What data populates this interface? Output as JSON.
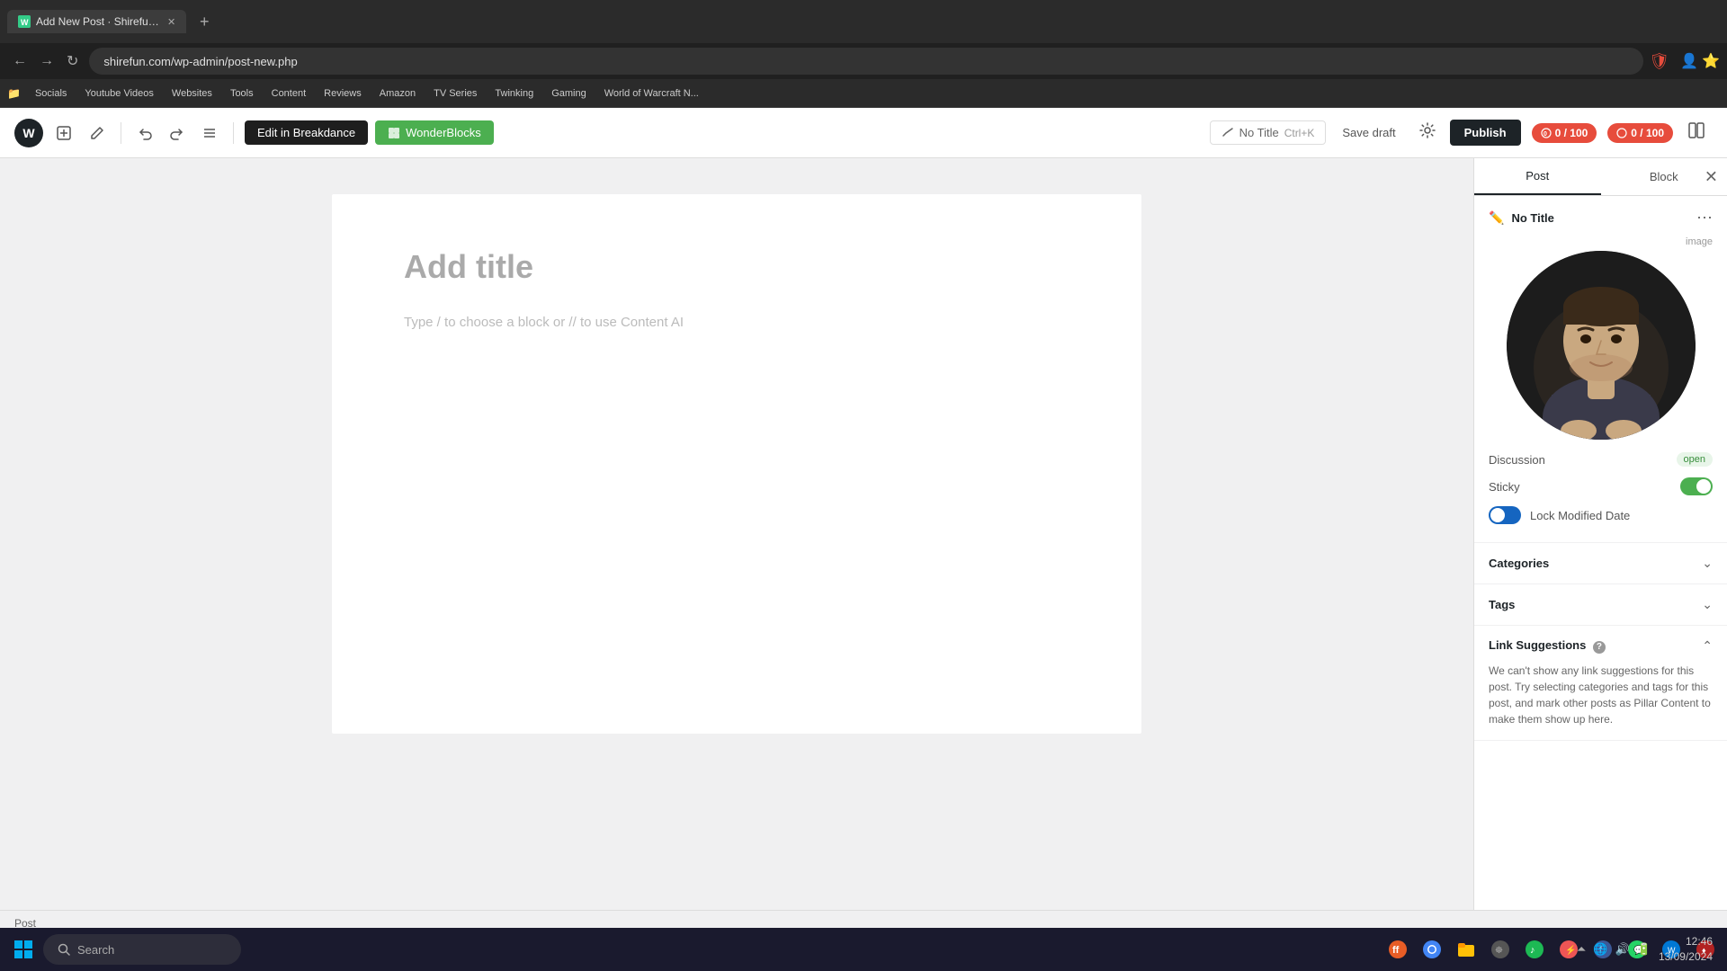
{
  "browser": {
    "tab": {
      "title": "Add New Post · Shirefun — Wo...",
      "favicon": "W"
    },
    "address": "shirefun.com/wp-admin/post-new.php",
    "bookmarks": [
      {
        "label": "Socials"
      },
      {
        "label": "Youtube Videos"
      },
      {
        "label": "Websites"
      },
      {
        "label": "Tools"
      },
      {
        "label": "Content"
      },
      {
        "label": "Reviews"
      },
      {
        "label": "Amazon"
      },
      {
        "label": "TV Series"
      },
      {
        "label": "Twinking"
      },
      {
        "label": "Gaming"
      },
      {
        "label": "World of Warcraft N..."
      }
    ]
  },
  "toolbar": {
    "breakdance_label": "Edit in Breakdance",
    "wonderblocks_label": "WonderBlocks",
    "no_title": "No Title",
    "keyboard_hint": "Ctrl+K",
    "save_draft": "Save draft",
    "publish": "Publish",
    "score1": "0 / 100",
    "score2": "0 / 100"
  },
  "editor": {
    "title_placeholder": "Add title",
    "body_placeholder": "Type / to choose a block or // to use Content AI"
  },
  "sidebar": {
    "tab_post": "Post",
    "tab_block": "Block",
    "no_title": "No Title",
    "featured_image_label": "image",
    "discussion_label": "Discussion",
    "discussion_status": "open",
    "sticky_label": "Sticky",
    "lock_modified_label": "Lock Modified Date",
    "categories_label": "Categories",
    "tags_label": "Tags",
    "link_suggestions_label": "Link Suggestions",
    "link_suggestions_text": "We can't show any link suggestions for this post. Try selecting categories and tags for this post, and mark other posts as Pillar Content to make them show up here."
  },
  "status_bar": {
    "post_label": "Post"
  },
  "taskbar": {
    "search_placeholder": "Search"
  },
  "system_tray": {
    "time": "12:46",
    "date": "13/09/2024"
  }
}
